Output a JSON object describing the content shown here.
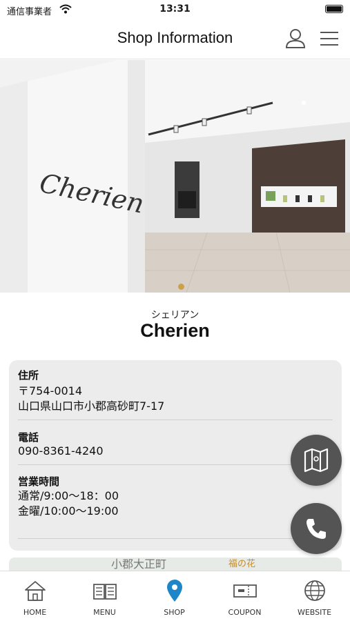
{
  "status_bar": {
    "carrier": "通信事業者",
    "time": "13:31"
  },
  "header": {
    "title": "Shop Information"
  },
  "shop": {
    "name_kana": "シェリアン",
    "name": "Cherien"
  },
  "info": {
    "address": {
      "label": "住所",
      "postal": "〒754-0014",
      "street": "山口県山口市小郡高砂町7-17"
    },
    "phone": {
      "label": "電話",
      "number": "090-8361-4240"
    },
    "hours": {
      "label": "営業時間",
      "line1": "通常/9:00〜18：00",
      "line2": "金曜/10:00〜19:00"
    }
  },
  "map": {
    "place1": "小郡大正町",
    "place2": "福の花"
  },
  "tabs": [
    {
      "label": "HOME",
      "icon": "home-icon"
    },
    {
      "label": "MENU",
      "icon": "book-icon"
    },
    {
      "label": "SHOP",
      "icon": "location-pin-icon"
    },
    {
      "label": "COUPON",
      "icon": "ticket-icon"
    },
    {
      "label": "WEBSITE",
      "icon": "globe-icon"
    }
  ],
  "colors": {
    "active_tab": "#1e86c8",
    "fab": "#545454",
    "card": "#ececec",
    "page_dot": "#c9a24a"
  },
  "hero": {
    "logo_text": "Cherien"
  },
  "carousel": {
    "current_page": 1
  }
}
